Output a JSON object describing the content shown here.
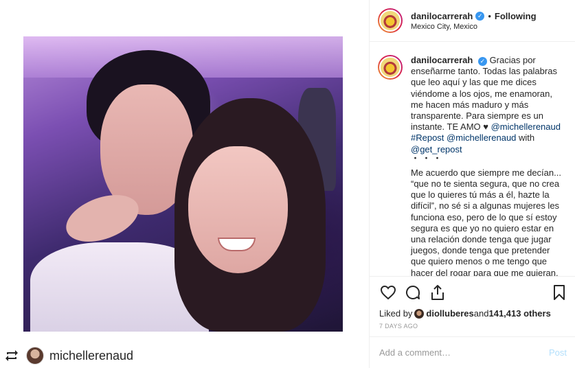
{
  "post": {
    "username": "danilocarrerah",
    "dot": "•",
    "follow_status": "Following",
    "location": "Mexico City, Mexico"
  },
  "caption": {
    "username": "danilocarrerah",
    "text_part1": " Gracias por enseñarme tanto. Todas las palabras que leo aquí y las que me dices viéndome a los ojos, me enamoran, me hacen más maduro y más transparente. Para siempre es un instante. TE AMO ",
    "heart": "♥",
    "mention1": "@michellerenaud",
    "repost_tag": "#Repost",
    "mention2": "@michellerenaud",
    "with_text": " with",
    "mention3": "@get_repost",
    "dots": "・・・",
    "paragraph2": "Me acuerdo que siempre me decían... “que no te sienta segura, que no crea que lo quieres tú más a él, hazte la difícil”, no sé si a algunas mujeres les funciona eso, pero de lo que sí estoy segura es que yo no quiero estar en una relación donde tenga que jugar juegos, donde tenga que pretender que quiero menos o me tengo que hacer del rogar para que me quieran."
  },
  "likes": {
    "prefix": "Liked by ",
    "liker": "diolluberes",
    "middle": " and ",
    "count": "141,413 others"
  },
  "timestamp": "7 DAYS AGO",
  "comment": {
    "placeholder": "Add a comment…",
    "post_label": "Post"
  },
  "repost": {
    "username": "michellerenaud"
  },
  "colors": {
    "link": "#003569",
    "verified": "#3897f0",
    "post_disabled": "#b2dffc"
  },
  "icons": {
    "verified": "verified-badge-icon",
    "like": "heart-icon",
    "comment": "comment-icon",
    "share": "share-icon",
    "save": "bookmark-icon",
    "repost": "repost-icon"
  }
}
